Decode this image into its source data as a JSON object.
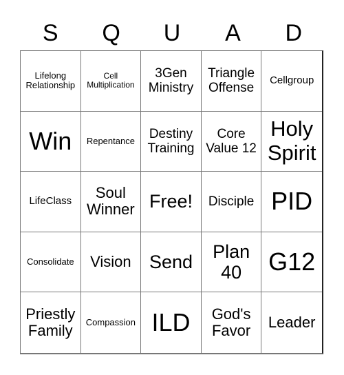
{
  "title_letters": [
    "S",
    "Q",
    "U",
    "A",
    "D"
  ],
  "cells": [
    {
      "text": "Lifelong Relationship",
      "size": "s2"
    },
    {
      "text": "Cell Multiplication",
      "size": "s1"
    },
    {
      "text": "3Gen Ministry",
      "size": "s4"
    },
    {
      "text": "Triangle Offense",
      "size": "s4"
    },
    {
      "text": "Cellgroup",
      "size": "s3"
    },
    {
      "text": "Win",
      "size": "s8"
    },
    {
      "text": "Repentance",
      "size": "s2"
    },
    {
      "text": "Destiny Training",
      "size": "s4"
    },
    {
      "text": "Core Value 12",
      "size": "s4"
    },
    {
      "text": "Holy Spirit",
      "size": "s7"
    },
    {
      "text": "LifeClass",
      "size": "s3"
    },
    {
      "text": "Soul Winner",
      "size": "s5"
    },
    {
      "text": "Free!",
      "size": "s6"
    },
    {
      "text": "Disciple",
      "size": "s4"
    },
    {
      "text": "PID",
      "size": "s8"
    },
    {
      "text": "Consolidate",
      "size": "s2"
    },
    {
      "text": "Vision",
      "size": "s5"
    },
    {
      "text": "Send",
      "size": "s6"
    },
    {
      "text": "Plan 40",
      "size": "s6"
    },
    {
      "text": "G12",
      "size": "s8"
    },
    {
      "text": "Priestly Family",
      "size": "s5"
    },
    {
      "text": "Compassion",
      "size": "s2"
    },
    {
      "text": "ILD",
      "size": "s8"
    },
    {
      "text": "God's Favor",
      "size": "s5"
    },
    {
      "text": "Leader",
      "size": "s5"
    }
  ]
}
